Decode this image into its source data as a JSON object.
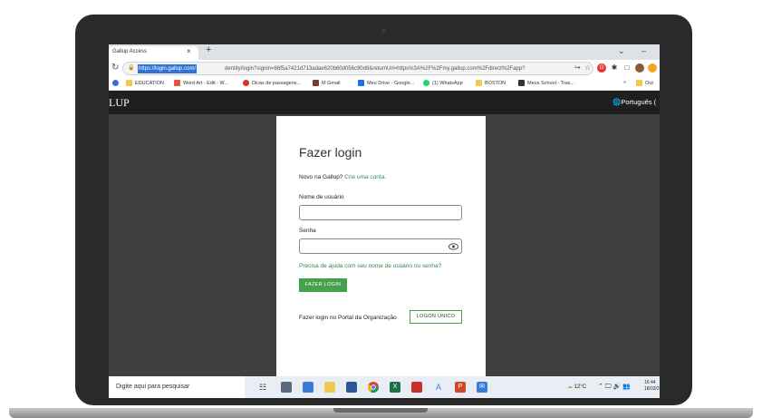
{
  "browser": {
    "tab_title": "Gallup Access",
    "tab_close": "×",
    "new_tab": "+",
    "win_minimize": "–",
    "win_chevron": "⌄",
    "url_highlight": "https://login.gallup.com/",
    "url_rest": "dentity/login?signin=86f5a7421d713adae620b60d056c90d8&returnUrl=https%3A%2F%2Fmy.gallup.com%2Fdirect%2Fapp?",
    "bookmarks": [
      {
        "label": "EDUCATION",
        "color": "#f2c94c"
      },
      {
        "label": "Word Art - Edit - W...",
        "color": "#e5553b"
      },
      {
        "label": "Dicas de passagens...",
        "color": "#d93025"
      },
      {
        "label": "M Gmail",
        "color": "#c5221f"
      },
      {
        "label": "Meu Drive - Google...",
        "color": "#1a73e8"
      },
      {
        "label": "(1) WhatsApp",
        "color": "#25d366"
      },
      {
        "label": "BOSTON",
        "color": "#f2c94c"
      },
      {
        "label": "Meus School - Tras...",
        "color": "#333333"
      },
      {
        "label": "»",
        "color": "#ffffff"
      },
      {
        "label": "Out",
        "color": "#f2c94c"
      }
    ]
  },
  "page": {
    "brand": "LUP",
    "language": "Português (",
    "title": "Fazer login",
    "signup_prefix": "Novo na Gallup?",
    "signup_link": "Crie uma conta.",
    "username_label": "Nome de usuário",
    "password_label": "Senha",
    "help_link": "Precisa de ajuda com seu nome de usuário ou senha?",
    "login_button": "FAZER LOGIN",
    "org_text": "Fazer login no Portal da Organização",
    "sso_button": "LOGON ÚNICO"
  },
  "taskbar": {
    "search_placeholder": "Digite aqui para pesquisar",
    "weather": "12°C",
    "time": "16:44",
    "date": "18/03/2"
  },
  "colors": {
    "accent_green": "#44a24c",
    "link_green": "#2f8a4a",
    "url_highlight": "#2f72d8"
  }
}
